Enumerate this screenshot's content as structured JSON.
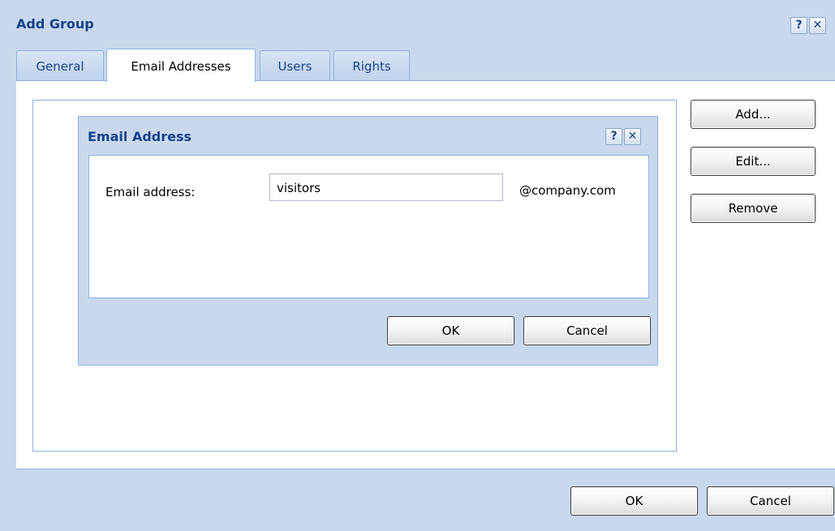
{
  "window": {
    "title": "Add Group",
    "help_glyph": "?",
    "close_glyph": "✕"
  },
  "tabs": [
    {
      "label": "General",
      "active": false
    },
    {
      "label": "Email Addresses",
      "active": true
    },
    {
      "label": "Users",
      "active": false
    },
    {
      "label": "Rights",
      "active": false
    }
  ],
  "side_buttons": {
    "add": "Add...",
    "edit": "Edit...",
    "remove": "Remove"
  },
  "dialog": {
    "title": "Email Address",
    "help_glyph": "?",
    "close_glyph": "✕",
    "field_label": "Email address:",
    "field_value": "visitors",
    "domain": "@company.com",
    "ok": "OK",
    "cancel": "Cancel"
  },
  "footer": {
    "ok": "OK",
    "cancel": "Cancel"
  }
}
